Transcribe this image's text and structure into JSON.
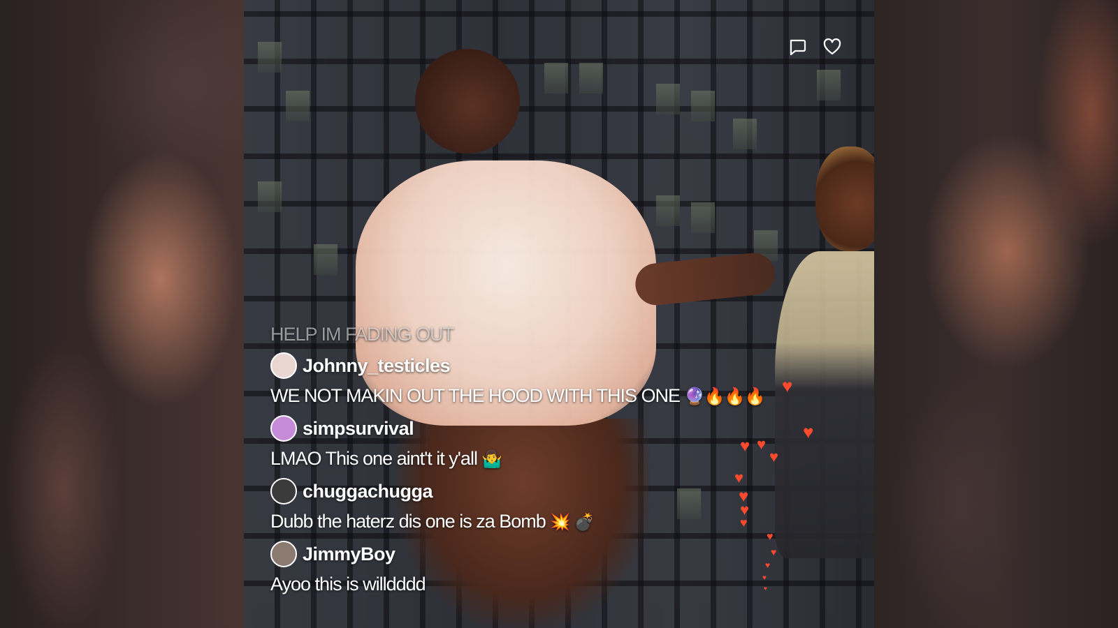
{
  "overlay": {
    "actions": {
      "comment_icon": "speech-bubble",
      "like_icon": "heart"
    },
    "status_text": "HELP IM FADING OUT",
    "comments": [
      {
        "username": "Johnny_testicles",
        "message": "WE NOT MAKIN OUT THE HOOD WITH THIS ONE",
        "emoji": "🔮🔥🔥🔥",
        "avatar_color": "#e9d6d0"
      },
      {
        "username": "simpsurvival",
        "message": "LMAO This one aint't it y'all",
        "emoji": "🤷‍♂️",
        "avatar_color": "#c58bd9"
      },
      {
        "username": "chuggachugga",
        "message": "Dubb the haterz dis one is za Bomb",
        "emoji": "💥 💣",
        "avatar_color": "#3b3b3b"
      },
      {
        "username": "JimmyBoy",
        "message": "Ayoo this is willdddd",
        "emoji": "",
        "avatar_color": "#8b7a70"
      }
    ],
    "accent_color": "#ff4a2e"
  }
}
